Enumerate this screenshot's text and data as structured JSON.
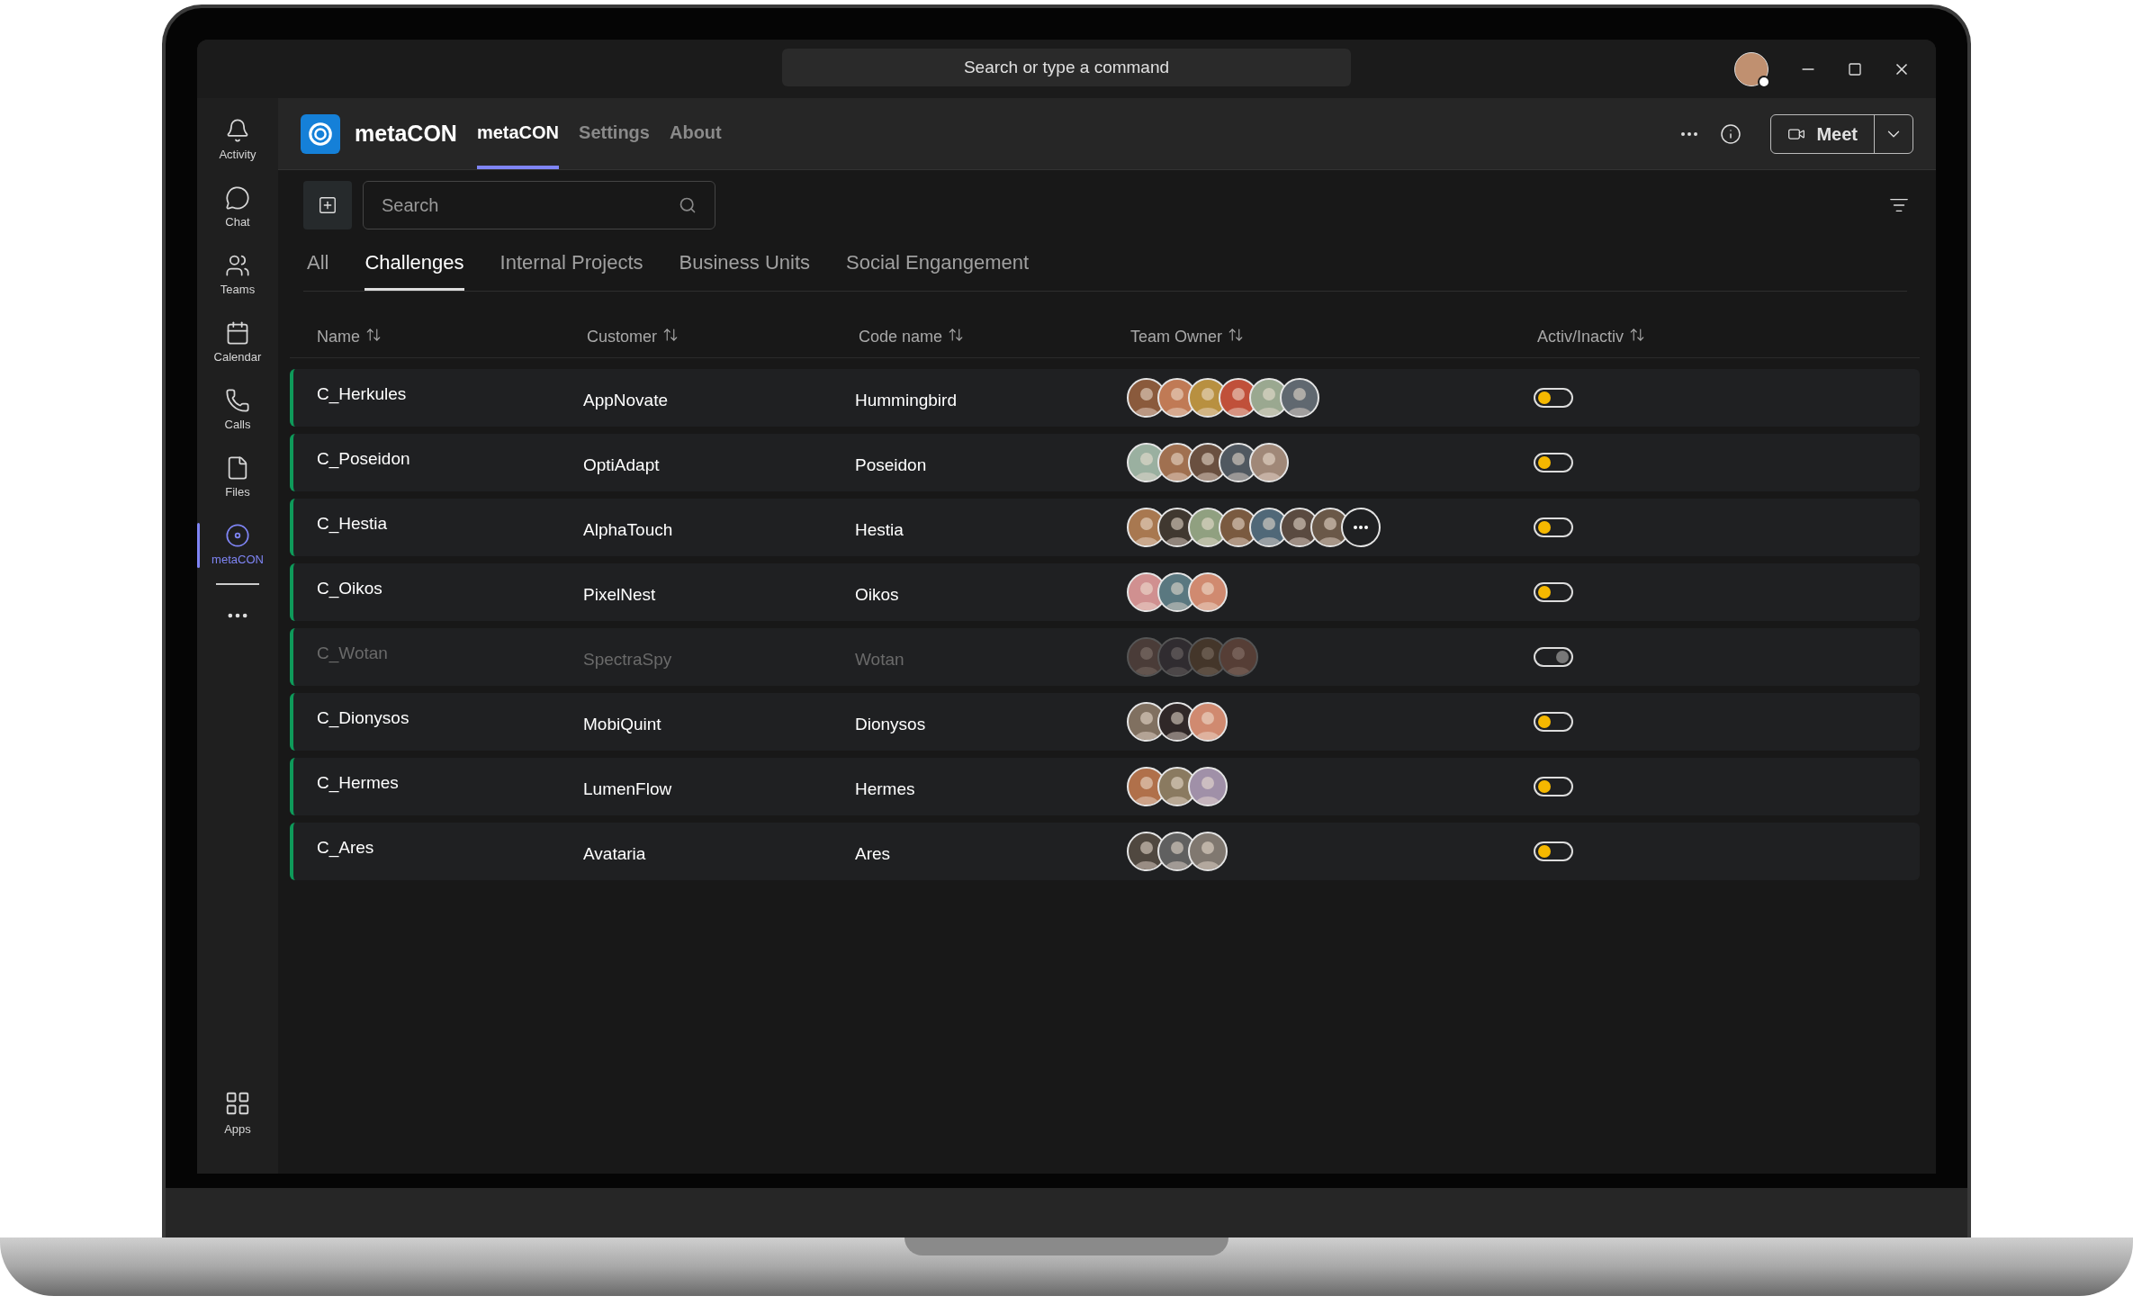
{
  "title_bar": {
    "search_placeholder": "Search or type a command"
  },
  "rail": [
    {
      "kind": "bell",
      "label": "Activity",
      "selected": false
    },
    {
      "kind": "chat",
      "label": "Chat",
      "selected": false
    },
    {
      "kind": "teams",
      "label": "Teams",
      "selected": false
    },
    {
      "kind": "calendar",
      "label": "Calendar",
      "selected": false
    },
    {
      "kind": "calls",
      "label": "Calls",
      "selected": false
    },
    {
      "kind": "files",
      "label": "Files",
      "selected": false
    },
    {
      "kind": "app",
      "label": "metaCON",
      "selected": true
    }
  ],
  "rail_bottom": {
    "label": "Apps"
  },
  "app_header": {
    "app_name": "metaCON",
    "tabs": [
      {
        "label": "metaCON",
        "selected": true
      },
      {
        "label": "Settings",
        "selected": false
      },
      {
        "label": "About",
        "selected": false
      }
    ],
    "meet_button": "Meet"
  },
  "search": {
    "placeholder": "Search"
  },
  "category_tabs": [
    {
      "label": "All",
      "selected": false
    },
    {
      "label": "Challenges",
      "selected": true
    },
    {
      "label": "Internal Projects",
      "selected": false
    },
    {
      "label": "Business Units",
      "selected": false
    },
    {
      "label": "Social Engangement",
      "selected": false
    }
  ],
  "table": {
    "columns": [
      "Name",
      "Customer",
      "Code name",
      "Team Owner",
      "Activ/Inactiv"
    ],
    "rows": [
      {
        "name": "C_Herkules",
        "customer": "AppNovate",
        "code_name": "Hummingbird",
        "inactive": false,
        "overflow": false,
        "owners": [
          {
            "color": "#8a5a3c"
          },
          {
            "color": "#c07a55"
          },
          {
            "color": "#b89040"
          },
          {
            "color": "#c0503a"
          },
          {
            "color": "#9aa890"
          },
          {
            "color": "#606870"
          }
        ]
      },
      {
        "name": "C_Poseidon",
        "customer": "OptiAdapt",
        "code_name": "Poseidon",
        "inactive": false,
        "overflow": false,
        "owners": [
          {
            "color": "#9ab0a0"
          },
          {
            "color": "#a07050"
          },
          {
            "color": "#6a5040"
          },
          {
            "color": "#505860"
          },
          {
            "color": "#a08878"
          }
        ]
      },
      {
        "name": "C_Hestia",
        "customer": "AlphaTouch",
        "code_name": "Hestia",
        "inactive": false,
        "overflow": true,
        "owners": [
          {
            "color": "#a87850"
          },
          {
            "color": "#403830"
          },
          {
            "color": "#90a080"
          },
          {
            "color": "#7a5a40"
          },
          {
            "color": "#506878"
          },
          {
            "color": "#5a4a40"
          },
          {
            "color": "#6a5848"
          }
        ]
      },
      {
        "name": "C_Oikos",
        "customer": "PixelNest",
        "code_name": "Oikos",
        "inactive": false,
        "overflow": false,
        "owners": [
          {
            "color": "#d09090"
          },
          {
            "color": "#5a7880"
          },
          {
            "color": "#d08a70"
          }
        ]
      },
      {
        "name": "C_Wotan",
        "customer": "SpectraSpy",
        "code_name": "Wotan",
        "inactive": true,
        "overflow": false,
        "owners": [
          {
            "color": "#4a3c38"
          },
          {
            "color": "#302c30"
          },
          {
            "color": "#44362a"
          },
          {
            "color": "#563e36"
          }
        ]
      },
      {
        "name": "C_Dionysos",
        "customer": "MobiQuint",
        "code_name": "Dionysos",
        "inactive": false,
        "overflow": false,
        "owners": [
          {
            "color": "#807060"
          },
          {
            "color": "#302828"
          },
          {
            "color": "#d08a70"
          }
        ]
      },
      {
        "name": "C_Hermes",
        "customer": "LumenFlow",
        "code_name": "Hermes",
        "inactive": false,
        "overflow": false,
        "owners": [
          {
            "color": "#b0704a"
          },
          {
            "color": "#8a7a60"
          },
          {
            "color": "#a090a8"
          }
        ]
      },
      {
        "name": "C_Ares",
        "customer": "Avataria",
        "code_name": "Ares",
        "inactive": false,
        "overflow": false,
        "owners": [
          {
            "color": "#504840"
          },
          {
            "color": "#606060"
          },
          {
            "color": "#807870"
          }
        ]
      }
    ]
  }
}
